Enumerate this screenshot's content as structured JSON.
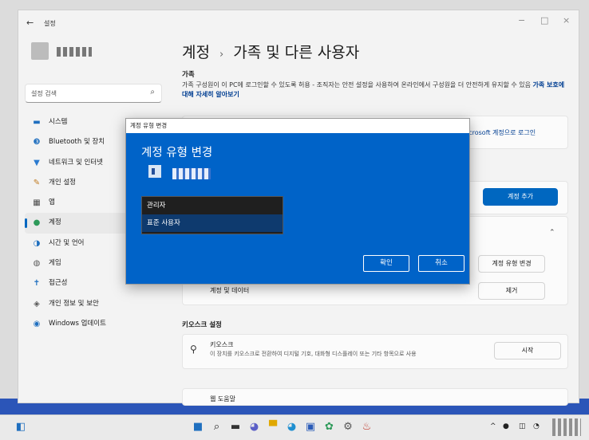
{
  "window": {
    "back_glyph": "←",
    "app_title": "설정",
    "controls": [
      "−",
      "□",
      "×"
    ]
  },
  "sidebar": {
    "search_placeholder": "설정 검색",
    "items": [
      {
        "icon": "system-icon",
        "glyph": "▬",
        "color": "#1f6fbf",
        "label": "시스템"
      },
      {
        "icon": "bluetooth-icon",
        "glyph": "❸",
        "color": "#1f6fbf",
        "label": "Bluetooth 및 장치"
      },
      {
        "icon": "network-icon",
        "glyph": "▼",
        "color": "#2b7bd0",
        "label": "네트워크 및 인터넷"
      },
      {
        "icon": "personalization-icon",
        "glyph": "✎",
        "color": "#c07b20",
        "label": "개인 설정"
      },
      {
        "icon": "apps-icon",
        "glyph": "▦",
        "color": "#4a4a4a",
        "label": "앱"
      },
      {
        "icon": "accounts-icon",
        "glyph": "●",
        "color": "#2e9a5a",
        "label": "계정"
      },
      {
        "icon": "time-language-icon",
        "glyph": "◑",
        "color": "#1f6fbf",
        "label": "시간 및 언어"
      },
      {
        "icon": "gaming-icon",
        "glyph": "◍",
        "color": "#5a5a5a",
        "label": "게임"
      },
      {
        "icon": "accessibility-icon",
        "glyph": "✝",
        "color": "#1f6fbf",
        "label": "접근성"
      },
      {
        "icon": "privacy-icon",
        "glyph": "◈",
        "color": "#5a5a5a",
        "label": "개인 정보 및 보안"
      },
      {
        "icon": "windows-update-icon",
        "glyph": "◉",
        "color": "#1f6fbf",
        "label": "Windows 업데이트"
      }
    ],
    "active_index": 5
  },
  "main": {
    "breadcrumb_parent": "계정",
    "breadcrumb_sep": "›",
    "breadcrumb_current": "가족 및 다른 사용자",
    "family_heading": "가족",
    "family_desc": "가족 구성원이 이 PC에 로그인할 수 있도록 허용 - 조직자는 안전 설정을 사용하여 온라인에서 구성원을 더 안전하게 유지할 수 있음",
    "family_link": "가족 보호에 대해 자세히 알아보기",
    "ms_login_link": "icrosoft 계정으로 로그인",
    "add_account_label": "계정 추가",
    "expand_chevron": "⌃",
    "change_type_label": "계정 유형 변경",
    "account_data_label": "계정 및 데이터",
    "remove_label": "제거",
    "kiosk_heading": "키오스크 설정",
    "kiosk_title": "키오스크",
    "kiosk_desc": "이 장치를 키오스크로 전환하여 디지털 기호, 대화형 디스플레이 또는 기타 항목으로 사용",
    "start_label": "시작",
    "help_label": "웹 도움말"
  },
  "dialog": {
    "caption": "계정 유형 변경",
    "heading": "계정 유형 변경",
    "options": [
      "관리자",
      "표준 사용자"
    ],
    "selected_index": 1,
    "ok_label": "확인",
    "cancel_label": "취소"
  },
  "taskbar": {
    "widgets_glyph": "◧",
    "pinned": [
      {
        "icon": "start-icon",
        "glyph": "■",
        "color": "#1f6fbf"
      },
      {
        "icon": "search-icon",
        "glyph": "⌕",
        "color": "#222"
      },
      {
        "icon": "task-view-icon",
        "glyph": "▬",
        "color": "#333"
      },
      {
        "icon": "chat-icon",
        "glyph": "◕",
        "color": "#5b5fc7"
      },
      {
        "icon": "file-explorer-icon",
        "glyph": "▀",
        "color": "#e0a800"
      },
      {
        "icon": "edge-icon",
        "glyph": "◕",
        "color": "#1f8fd0"
      },
      {
        "icon": "store-icon",
        "glyph": "▣",
        "color": "#2b5cb8"
      },
      {
        "icon": "app-icon",
        "glyph": "✿",
        "color": "#2e9a5a"
      },
      {
        "icon": "settings-icon",
        "glyph": "⚙",
        "color": "#555"
      },
      {
        "icon": "paint-icon",
        "glyph": "♨",
        "color": "#c0392b"
      }
    ],
    "tray": [
      "^",
      "●",
      "◫",
      "◔"
    ]
  }
}
